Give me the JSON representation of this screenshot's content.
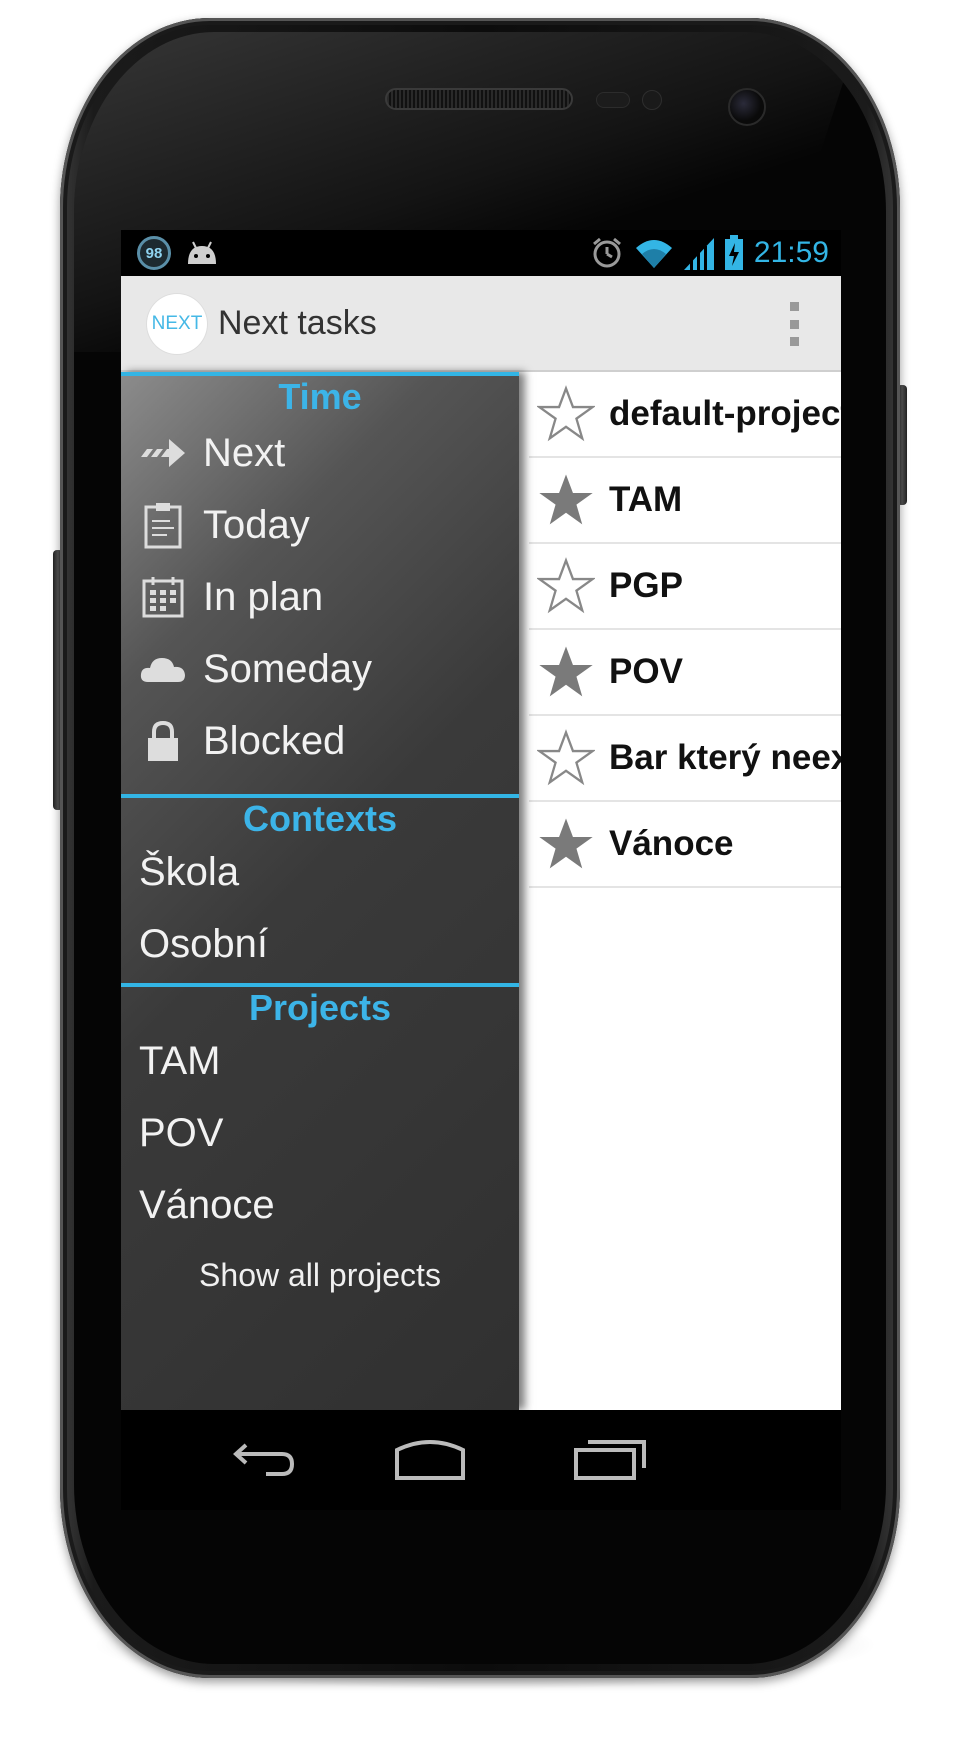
{
  "status_bar": {
    "badge_count": "98",
    "time": "21:59",
    "accent_color": "#33b5e5",
    "icons": [
      "alarm-icon",
      "wifi-icon",
      "signal-icon",
      "battery-charging-icon"
    ]
  },
  "action_bar": {
    "logo_text": "NEXT",
    "title": "Next tasks"
  },
  "drawer": {
    "time_section": {
      "title": "Time",
      "items": [
        {
          "label": "Next",
          "icon": "arrow-right-icon"
        },
        {
          "label": "Today",
          "icon": "clipboard-icon"
        },
        {
          "label": "In plan",
          "icon": "calendar-icon"
        },
        {
          "label": "Someday",
          "icon": "cloud-icon"
        },
        {
          "label": "Blocked",
          "icon": "lock-icon"
        }
      ]
    },
    "contexts_section": {
      "title": "Contexts",
      "items": [
        "Škola",
        "Osobní"
      ]
    },
    "projects_section": {
      "title": "Projects",
      "items": [
        "TAM",
        "POV",
        "Vánoce"
      ],
      "show_all": "Show all projects"
    }
  },
  "tasks": [
    {
      "label": "default-project",
      "starred": false
    },
    {
      "label": "TAM",
      "starred": true
    },
    {
      "label": "PGP",
      "starred": false
    },
    {
      "label": "POV",
      "starred": true
    },
    {
      "label": "Bar který neexistuje",
      "starred": false
    },
    {
      "label": "Vánoce",
      "starred": true
    }
  ]
}
